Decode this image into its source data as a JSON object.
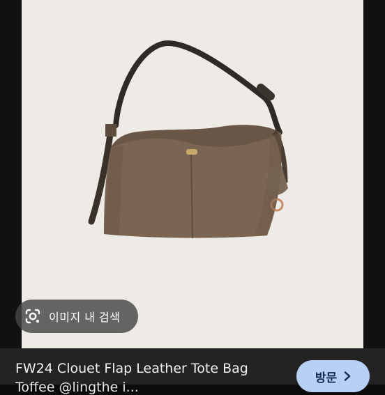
{
  "lens": {
    "label": "이미지 내 검색",
    "icon": "google-lens-icon"
  },
  "result": {
    "title": "FW24 Clouet Flap Leather Tote Bag",
    "subtitle": "Toffee @lingthe i..."
  },
  "visit_button": {
    "label": "방문",
    "icon": "chevron-right-icon"
  },
  "colors": {
    "photo_background": "#eeebe6",
    "bag_leather": "#7a6553",
    "button_background": "#b7d0f5"
  }
}
